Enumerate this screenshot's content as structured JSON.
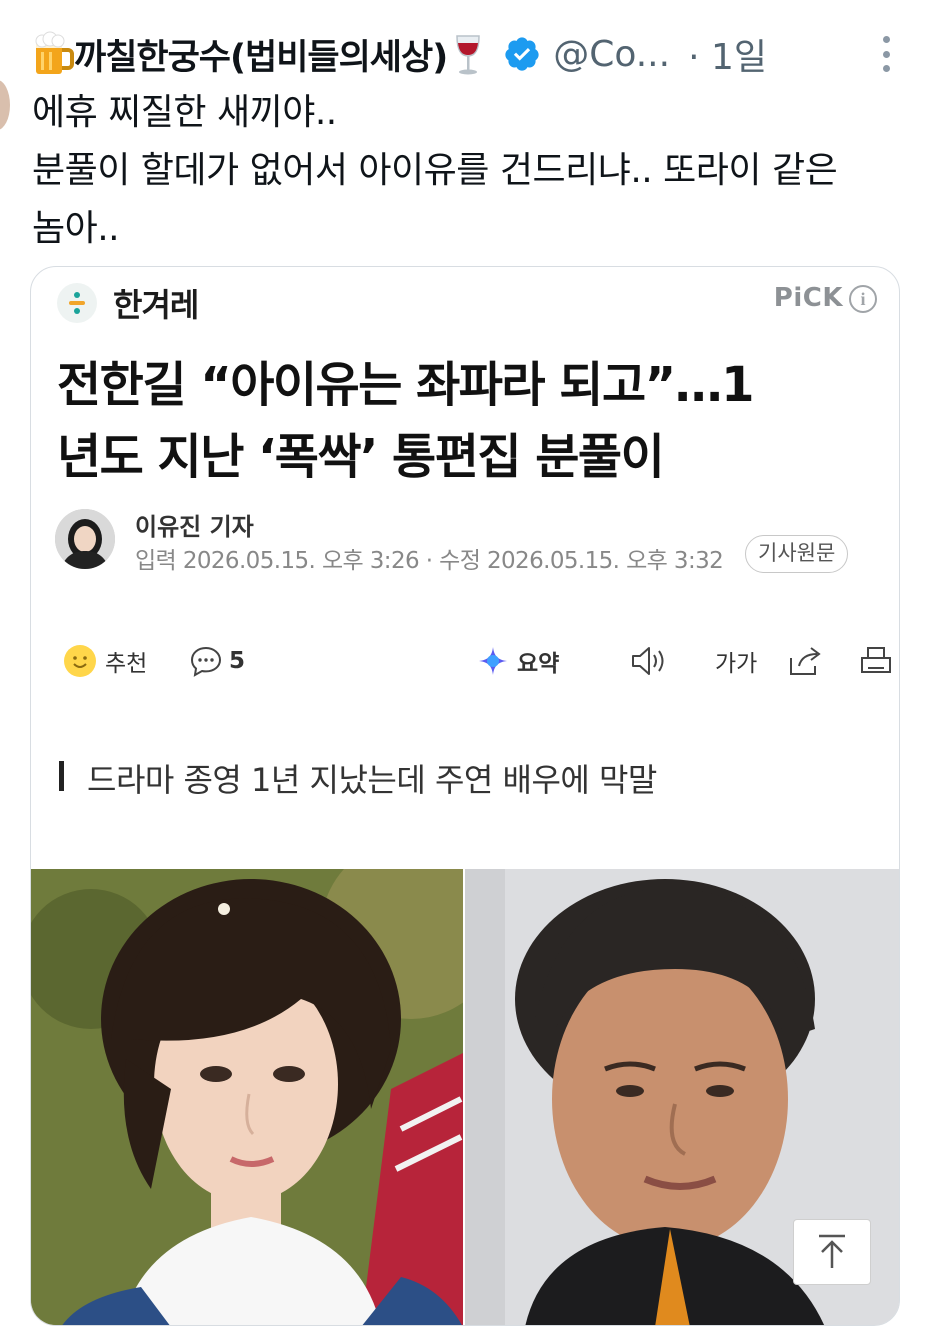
{
  "tweet": {
    "display_name": "까칠한궁수(법비들의세상)",
    "name_emoji_left": "beer-mug-icon",
    "name_emoji_right": "wine-glass-icon",
    "verified": true,
    "handle": "@Co...",
    "time_ago": "· 1일",
    "text_lines": [
      "에휴 찌질한 새끼야..",
      "분풀이 할데가 없어서 아이유를 건드리냐.. 또라이 같은",
      "놈아.."
    ]
  },
  "card": {
    "publisher": "한겨레",
    "pick_label": "PiCK",
    "headline_lines": [
      "전한길 “아이유는 좌파라 되고”…1",
      "년도 지난 ‘폭싹’ 통편집 분풀이"
    ],
    "reporter": "이유진 기자",
    "dateline": "입력 2026.05.15. 오후 3:26 · 수정 2026.05.15. 오후 3:32",
    "original_button": "기사원문",
    "actions": {
      "recommend_label": "추천",
      "comments_count": "5",
      "summary_label": "요약",
      "font_size_label": "가가"
    },
    "subhead": "드라마 종영 1년 지났는데 주연 배우에 막말"
  },
  "colors": {
    "verified_blue": "#1d9bf0",
    "secondary_text": "#536471",
    "card_border": "#d8dde2"
  }
}
